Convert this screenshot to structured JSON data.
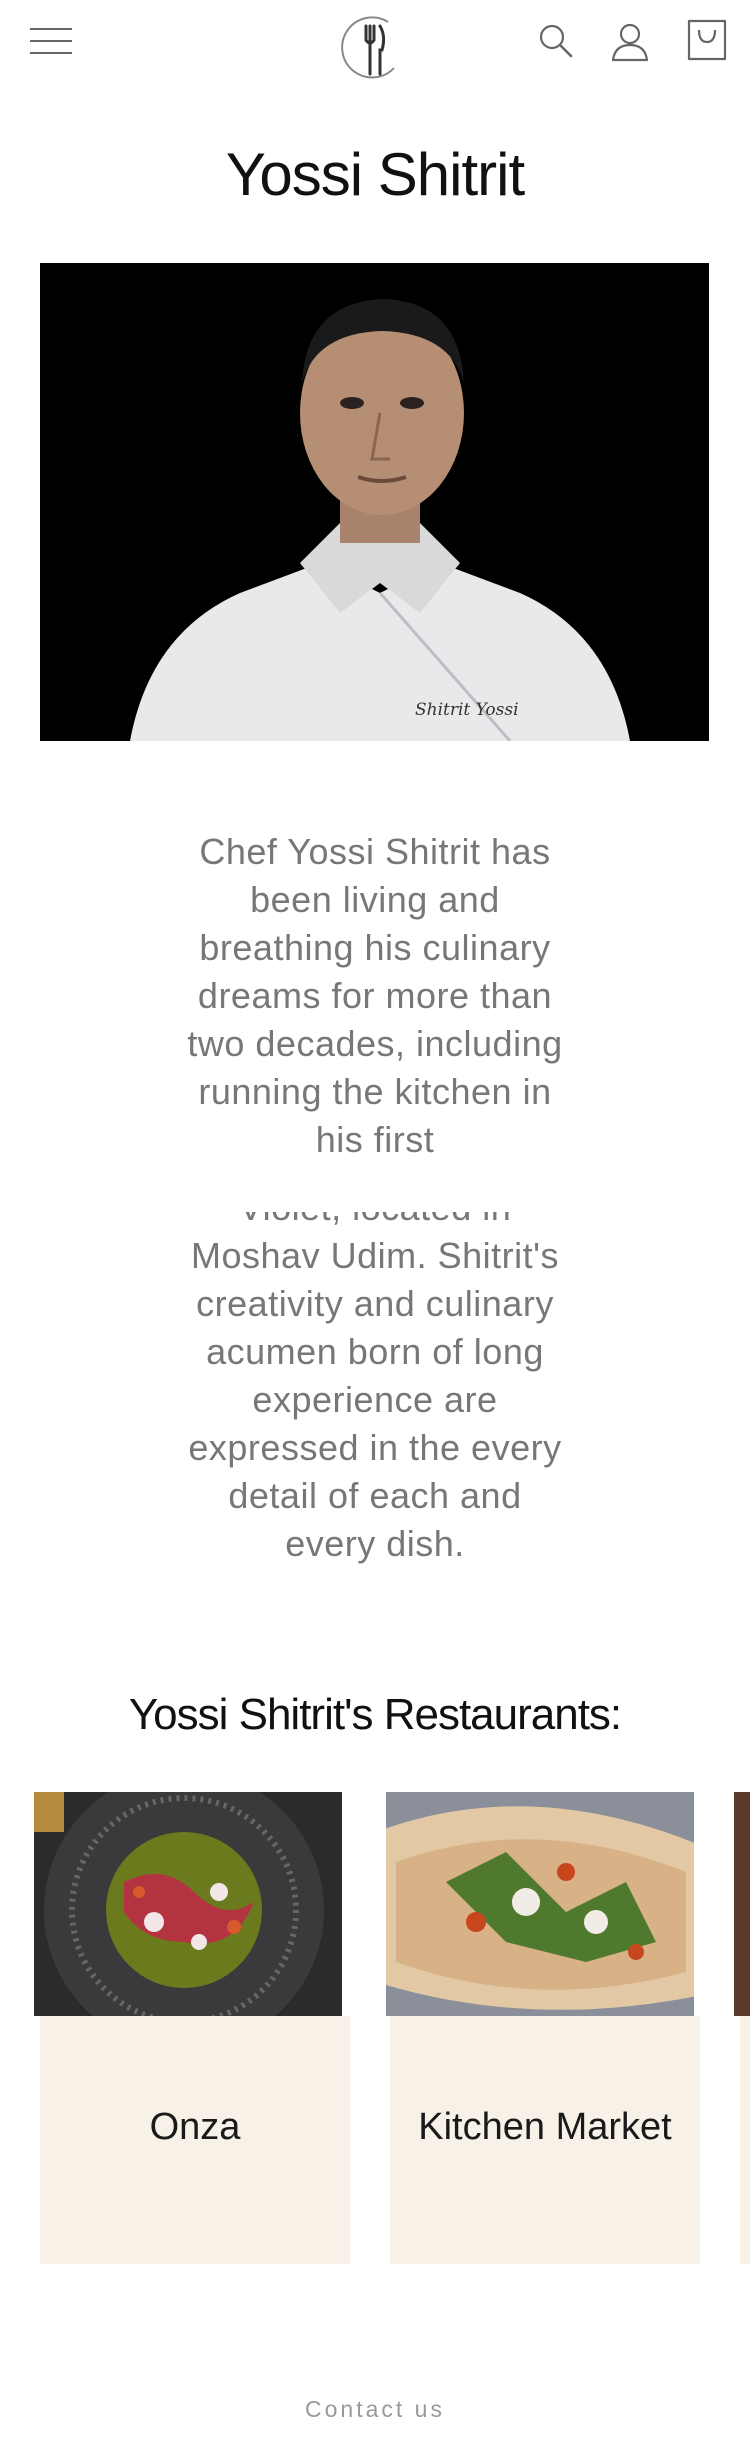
{
  "header": {
    "icons": [
      "menu-icon",
      "fork-knife-logo-icon",
      "search-icon",
      "user-icon",
      "shopping-bag-icon"
    ]
  },
  "chef": {
    "name": "Yossi Shitrit",
    "jacket_embroidery": "Shitrit Yossi",
    "bio_first": "Chef Yossi Shitrit has been living and breathing his culinary dreams for more than two decades, including running the kitchen in his first",
    "bio_second": "Violet, located in Moshav Udim. Shitrit's creativity and culinary acumen born of long experience are expressed in the every detail of each and every dish."
  },
  "restaurants": {
    "title": "Yossi Shitrit's Restaurants:",
    "items": [
      {
        "name": "Onza"
      },
      {
        "name": "Kitchen Market"
      }
    ]
  },
  "footer": {
    "contact_label": "Contact us"
  },
  "colors": {
    "card_background": "#f7f1e7",
    "text_muted": "#777777",
    "photo_background": "#000000"
  }
}
